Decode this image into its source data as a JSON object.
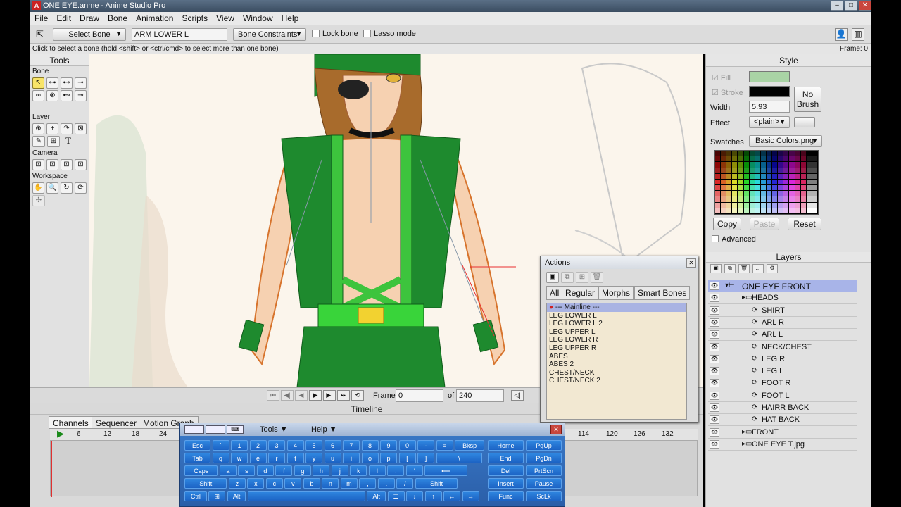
{
  "window": {
    "title": "ONE EYE.anme - Anime Studio Pro",
    "app_icon": "A"
  },
  "menu": [
    "File",
    "Edit",
    "Draw",
    "Bone",
    "Animation",
    "Scripts",
    "View",
    "Window",
    "Help"
  ],
  "toolbar": {
    "tool_select": "Select Bone",
    "bone_name": "ARM LOWER L",
    "constraints": "Bone Constraints",
    "lock_bone": "Lock bone",
    "lasso_mode": "Lasso mode"
  },
  "status": {
    "hint": "Click to select a bone (hold <shift> or <ctrl/cmd> to select more than one bone)",
    "frame": "Frame: 0"
  },
  "tools": {
    "title": "Tools",
    "sections": [
      "Bone",
      "Layer",
      "Camera",
      "Workspace"
    ],
    "text_tool": "T"
  },
  "playback": {
    "frame_label": "Frame",
    "frame_value": "0",
    "of_label": "of",
    "total_frames": "240"
  },
  "timeline": {
    "title": "Timeline",
    "tabs": [
      "Channels",
      "Sequencer",
      "Motion Graph"
    ],
    "ruler": [
      "6",
      "12",
      "18",
      "24",
      "114",
      "120",
      "126",
      "132"
    ]
  },
  "style": {
    "title": "Style",
    "fill_label": "Fill",
    "stroke_label": "Stroke",
    "no_brush": "No Brush",
    "width_label": "Width",
    "width_value": "5.93",
    "effect_label": "Effect",
    "effect_value": "<plain>",
    "effect_more": "...",
    "swatches_label": "Swatches",
    "swatches_value": "Basic Colors.png",
    "copy": "Copy",
    "paste": "Paste",
    "reset": "Reset",
    "advanced": "Advanced",
    "fill_color": "#a9d3a5",
    "stroke_color": "#000000"
  },
  "layers": {
    "title": "Layers",
    "items": [
      {
        "name": "ONE EYE FRONT",
        "indent": 0,
        "selected": true
      },
      {
        "name": "HEADS",
        "indent": 1
      },
      {
        "name": "SHIRT",
        "indent": 2
      },
      {
        "name": "ARL R",
        "indent": 2
      },
      {
        "name": "ARL L",
        "indent": 2
      },
      {
        "name": "NECK/CHEST",
        "indent": 2
      },
      {
        "name": "LEG R",
        "indent": 2
      },
      {
        "name": "LEG L",
        "indent": 2
      },
      {
        "name": "FOOT R",
        "indent": 2
      },
      {
        "name": "FOOT L",
        "indent": 2
      },
      {
        "name": "HAIRR BACK",
        "indent": 2
      },
      {
        "name": "HAT BACK",
        "indent": 2
      },
      {
        "name": "FRONT",
        "indent": 1
      },
      {
        "name": "ONE EYE T.jpg",
        "indent": 1
      }
    ]
  },
  "actions": {
    "title": "Actions",
    "tabs": [
      "All",
      "Regular",
      "Morphs",
      "Smart Bones"
    ],
    "mainline": "--- Mainline ---",
    "items": [
      "LEG LOWER L",
      "LEG LOWER L 2",
      "LEG UPPER L",
      "LEG LOWER R",
      "LEG UPPER R",
      "ABES",
      "ABES 2",
      "CHEST/NECK",
      "CHEST/NECK 2"
    ]
  },
  "keyboard": {
    "menu_tools": "Tools",
    "menu_help": "Help",
    "rows": [
      [
        "Esc",
        "`",
        "1",
        "2",
        "3",
        "4",
        "5",
        "6",
        "7",
        "8",
        "9",
        "0",
        "-",
        "=",
        "Bksp"
      ],
      [
        "Tab",
        "q",
        "w",
        "e",
        "r",
        "t",
        "y",
        "u",
        "i",
        "o",
        "p",
        "[",
        "]",
        "\\"
      ],
      [
        "Caps",
        "a",
        "s",
        "d",
        "f",
        "g",
        "h",
        "j",
        "k",
        "l",
        ";",
        "'",
        "⟵"
      ],
      [
        "Shift",
        "z",
        "x",
        "c",
        "v",
        "b",
        "n",
        "m",
        ",",
        ".",
        "/",
        "Shift"
      ],
      [
        "Ctrl",
        "⊞",
        "Alt",
        "",
        "Alt",
        "☰",
        "↓",
        "↑",
        "←",
        "→"
      ]
    ],
    "nav": [
      [
        "Home",
        "PgUp"
      ],
      [
        "End",
        "PgDn"
      ],
      [
        "Del",
        "PrtScn"
      ],
      [
        "Insert",
        "Pause"
      ],
      [
        "Func",
        "ScLk"
      ]
    ]
  }
}
